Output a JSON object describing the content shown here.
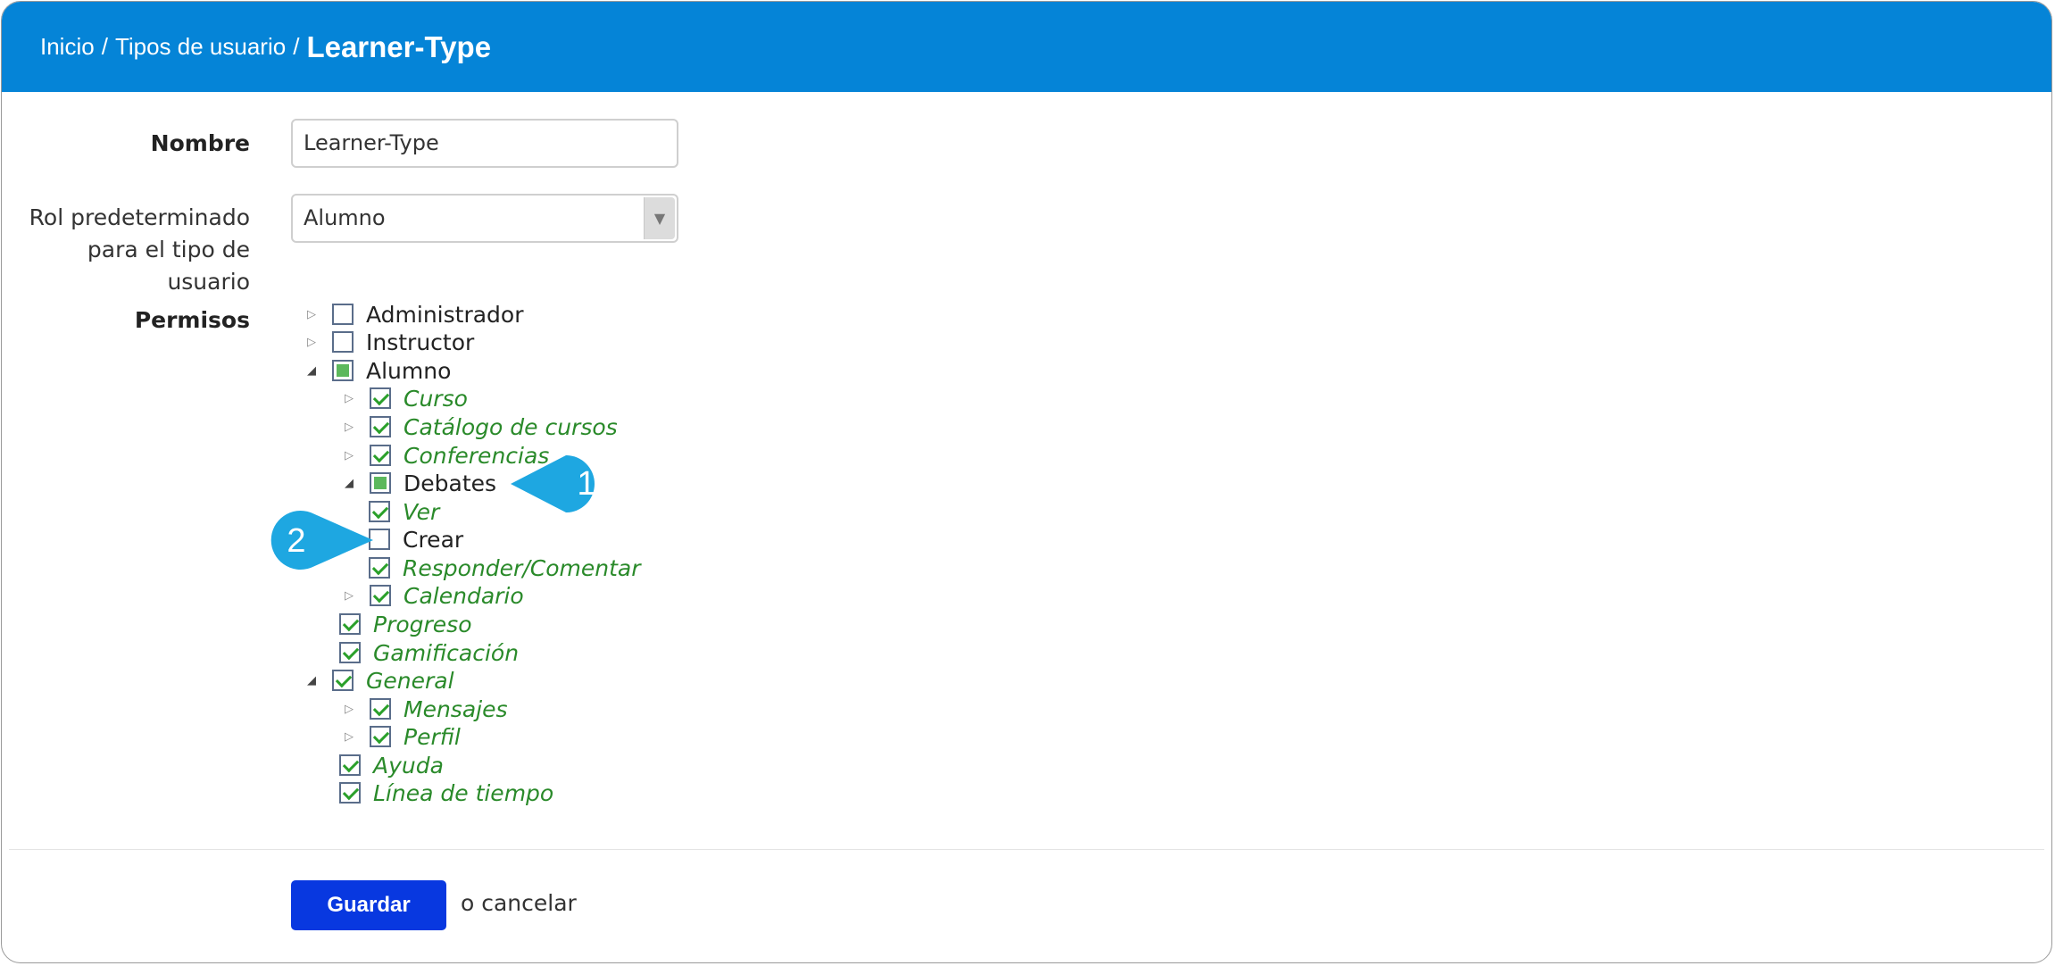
{
  "breadcrumb": {
    "home": "Inicio",
    "user_types": "Tipos de usuario",
    "separator": "/",
    "current": "Learner-Type"
  },
  "form": {
    "name_label": "Nombre",
    "name_value": "Learner-Type",
    "role_label_line1": "Rol predeterminado",
    "role_label_line2": "para el tipo de usuario",
    "role_value": "Alumno",
    "permissions_label": "Permisos"
  },
  "tree": [
    {
      "label": "Administrador",
      "state": "unchecked",
      "toggle": "collapsed"
    },
    {
      "label": "Instructor",
      "state": "unchecked",
      "toggle": "collapsed"
    },
    {
      "label": "Alumno",
      "state": "partial",
      "toggle": "expanded"
    },
    {
      "label": "Curso",
      "state": "checked",
      "toggle": "collapsed"
    },
    {
      "label": "Catálogo de cursos",
      "state": "checked",
      "toggle": "collapsed"
    },
    {
      "label": "Conferencias",
      "state": "checked",
      "toggle": "collapsed"
    },
    {
      "label": "Debates",
      "state": "partial",
      "toggle": "expanded"
    },
    {
      "label": "Ver",
      "state": "checked",
      "toggle": "none"
    },
    {
      "label": "Crear",
      "state": "unchecked",
      "toggle": "none"
    },
    {
      "label": "Responder/Comentar",
      "state": "checked",
      "toggle": "none"
    },
    {
      "label": "Calendario",
      "state": "checked",
      "toggle": "collapsed"
    },
    {
      "label": "Progreso",
      "state": "checked",
      "toggle": "none"
    },
    {
      "label": "Gamificación",
      "state": "checked",
      "toggle": "none"
    },
    {
      "label": "General",
      "state": "checked",
      "toggle": "expanded"
    },
    {
      "label": "Mensajes",
      "state": "checked",
      "toggle": "collapsed"
    },
    {
      "label": "Perfil",
      "state": "checked",
      "toggle": "collapsed"
    },
    {
      "label": "Ayuda",
      "state": "checked",
      "toggle": "none"
    },
    {
      "label": "Línea de tiempo",
      "state": "checked",
      "toggle": "none"
    }
  ],
  "actions": {
    "save": "Guardar",
    "cancel": "o cancelar"
  },
  "callouts": {
    "one": "1",
    "two": "2"
  },
  "colors": {
    "header": "#0584d7",
    "save_button": "#0838e0",
    "callout": "#1ea7e1",
    "checked_text": "#2a8a2a"
  }
}
